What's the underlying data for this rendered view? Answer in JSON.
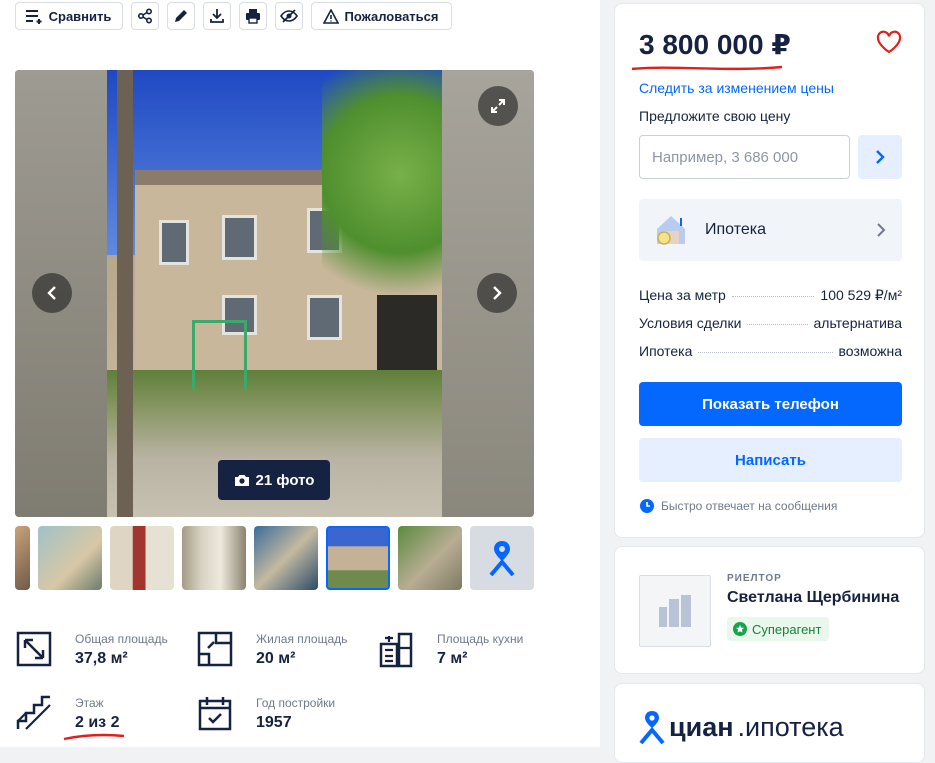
{
  "toolbar": {
    "compare_label": "Сравнить",
    "complain_label": "Пожаловаться",
    "icons": [
      "share-icon",
      "edit-icon",
      "download-icon",
      "print-icon",
      "hide-icon"
    ]
  },
  "gallery": {
    "photo_count": "21 фото",
    "thumbnails": 8
  },
  "specs": [
    {
      "label": "Общая площадь",
      "value": "37,8 м²",
      "icon": "area-icon"
    },
    {
      "label": "Жилая площадь",
      "value": "20 м²",
      "icon": "living-area-icon"
    },
    {
      "label": "Площадь кухни",
      "value": "7 м²",
      "icon": "kitchen-icon"
    },
    {
      "label": "Этаж",
      "value": "2 из 2",
      "icon": "stairs-icon"
    },
    {
      "label": "Год постройки",
      "value": "1957",
      "icon": "calendar-icon"
    }
  ],
  "sidebar": {
    "price": "3 800 000 ₽",
    "follow_price": "Следить за изменением цены",
    "offer_label": "Предложите свою цену",
    "offer_placeholder": "Например, 3 686 000",
    "mortgage_label": "Ипотека",
    "facts": [
      {
        "key": "Цена за метр",
        "value": "100 529 ₽/м²"
      },
      {
        "key": "Условия сделки",
        "value": "альтернатива"
      },
      {
        "key": "Ипотека",
        "value": "возможна"
      }
    ],
    "show_phone": "Показать телефон",
    "write": "Написать",
    "response_note": "Быстро отвечает на сообщения"
  },
  "agent": {
    "role": "РИЕЛТОР",
    "name": "Светлана Щербинина",
    "badge": "Суперагент"
  },
  "brand": {
    "name": "циан",
    "suffix": ".ипотека"
  },
  "colors": {
    "accent": "#0468ff",
    "text": "#152242",
    "muted": "#707a89",
    "annotation": "#e0201b"
  }
}
